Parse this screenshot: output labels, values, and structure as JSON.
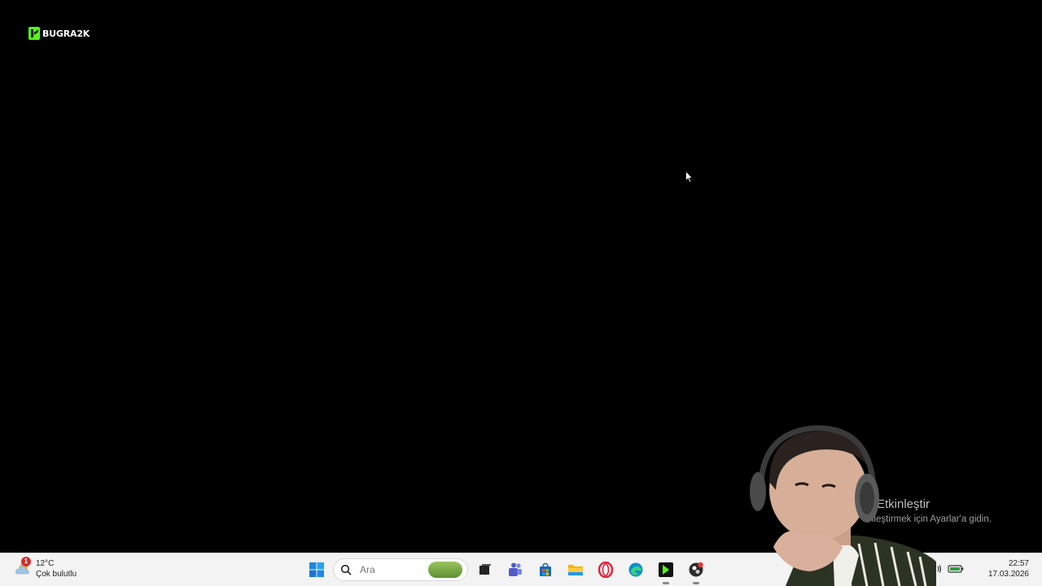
{
  "stream_logo": {
    "text": "BUGRA2K",
    "color": "#53fc18"
  },
  "activation_notice": {
    "title": "Etkinleştir",
    "subtitle": "nleştirmek için Ayarlar'a gidin."
  },
  "taskbar": {
    "weather": {
      "temperature": "12°C",
      "condition": "Çok bulutlu",
      "badge": "1",
      "icon": "cloud-icon"
    },
    "search": {
      "placeholder": "Ara",
      "value": ""
    },
    "apps": [
      {
        "name": "start",
        "icon": "windows-icon"
      },
      {
        "name": "task-view",
        "icon": "task-view-icon"
      },
      {
        "name": "teams",
        "icon": "teams-icon"
      },
      {
        "name": "store",
        "icon": "store-icon"
      },
      {
        "name": "file-explorer",
        "icon": "folder-icon"
      },
      {
        "name": "opera",
        "icon": "opera-icon"
      },
      {
        "name": "edge",
        "icon": "edge-icon"
      },
      {
        "name": "kick-studio",
        "icon": "kick-icon"
      },
      {
        "name": "obs",
        "icon": "obs-icon"
      }
    ],
    "clock": {
      "time": "22:57",
      "date": "17.03.2026"
    }
  },
  "colors": {
    "taskbar_bg": "#f3f3f3",
    "desktop_bg": "#000000",
    "accent": "#0078d4"
  }
}
